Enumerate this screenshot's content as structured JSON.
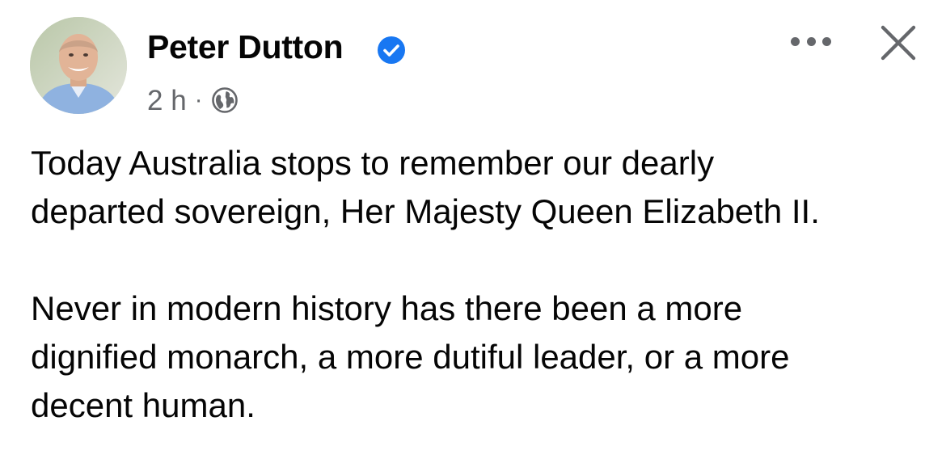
{
  "post": {
    "author": {
      "name": "Peter Dutton",
      "verified": true,
      "avatar_icon": "profile-photo"
    },
    "meta": {
      "time": "2 h",
      "separator": "·",
      "audience_icon": "globe-icon"
    },
    "actions": {
      "more_icon": "more-options-icon",
      "close_icon": "close-icon"
    },
    "paragraphs": [
      "Today Australia stops to remember our dearly\ndeparted sovereign, Her Majesty Queen Elizabeth II.",
      "Never in modern history has there been a more\ndignified monarch, a more dutiful leader, or a more\ndecent human."
    ]
  },
  "colors": {
    "text": "#050505",
    "secondary": "#65676b",
    "verified_badge": "#1877f2"
  }
}
